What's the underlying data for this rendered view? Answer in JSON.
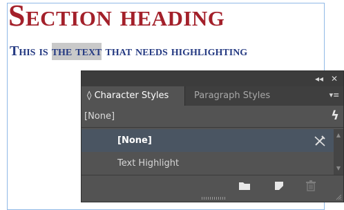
{
  "document": {
    "heading": "Section heading",
    "body_before": "This is ",
    "body_highlighted": "the text",
    "body_after": " that needs highlighting"
  },
  "panel": {
    "collapse_icon": "double-chevron-left-icon",
    "close_icon": "close-icon",
    "tabs": [
      {
        "label": "Character Styles",
        "active": true,
        "prefix": "◊"
      },
      {
        "label": "Paragraph Styles",
        "active": false
      }
    ],
    "menu_icon": "panel-menu-icon",
    "current_style": "[None]",
    "styles": [
      {
        "label": "[None]",
        "selected": true
      },
      {
        "label": "Text Highlight",
        "selected": false
      }
    ],
    "bottom_icons": [
      "folder-icon",
      "new-style-icon",
      "trash-icon"
    ]
  },
  "colors": {
    "heading": "#a3202a",
    "body_text": "#253a82",
    "highlight": "#c9c9c9",
    "panel_bg": "#535353",
    "selected_row": "#4a5562"
  }
}
